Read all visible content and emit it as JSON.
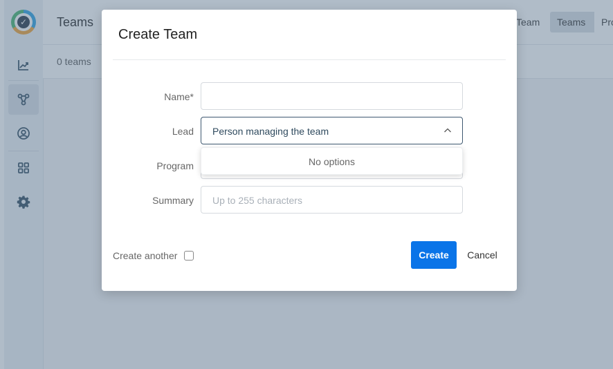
{
  "colors": {
    "overlay": "rgba(90,115,140,0.48)",
    "primary_button": "#0a74e8",
    "sidebar_icon": "#2f4a5e"
  },
  "sidebar": {
    "items": [
      {
        "icon": "app-logo-icon"
      },
      {
        "icon": "trend-chart-icon"
      },
      {
        "icon": "teams-network-icon",
        "active": true
      },
      {
        "icon": "person-circle-icon"
      },
      {
        "icon": "grid-apps-icon"
      },
      {
        "icon": "gear-icon"
      }
    ]
  },
  "header": {
    "title": "Teams",
    "segments": [
      "Team",
      "Teams",
      "Pro"
    ],
    "active_segment": "Teams"
  },
  "subheader": {
    "count_text": "0 teams"
  },
  "modal": {
    "title": "Create Team",
    "fields": {
      "name": {
        "label": "Name*",
        "value": "",
        "placeholder": ""
      },
      "lead": {
        "label": "Lead",
        "value": "Person managing the team"
      },
      "program": {
        "label": "Program",
        "value": ""
      },
      "summary": {
        "label": "Summary",
        "placeholder": "Up to 255 characters"
      }
    },
    "dropdown": {
      "empty_text": "No options"
    },
    "create_another_label": "Create another",
    "create_another_checked": false,
    "create_button": "Create",
    "cancel_button": "Cancel"
  }
}
